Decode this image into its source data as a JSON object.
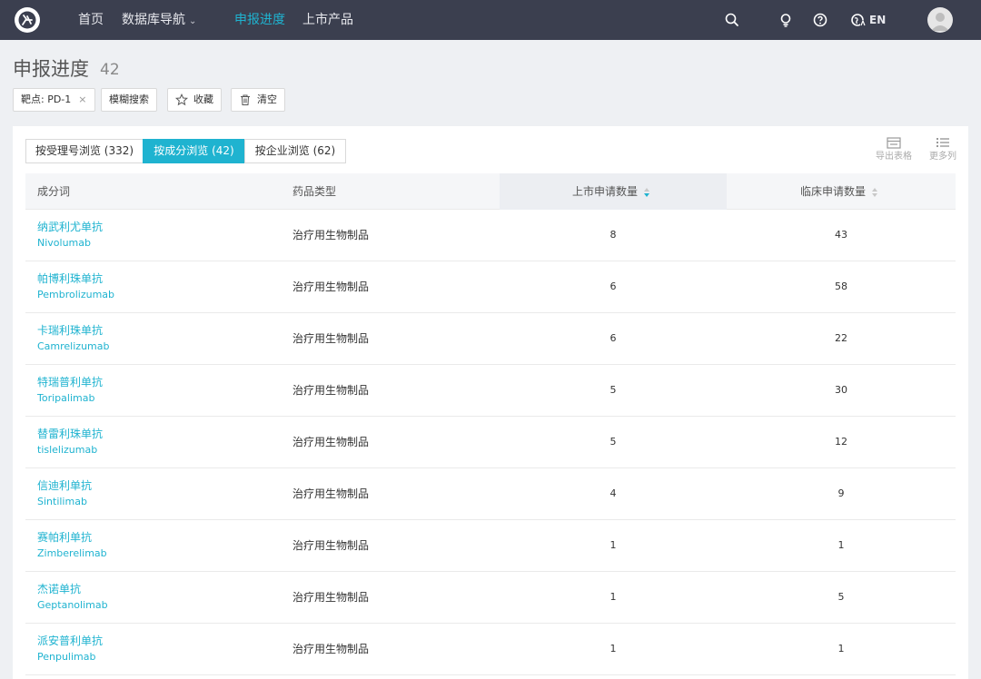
{
  "nav": {
    "items": [
      "首页",
      "数据库导航",
      "申报进度",
      "上市产品"
    ],
    "active_index": 2,
    "lang": "EN",
    "icons": [
      "logo-icon",
      "search-icon",
      "lightbulb-icon",
      "help-icon",
      "language-icon",
      "avatar-icon"
    ],
    "accent": "#1fb3d0",
    "bar_color": "#3b3f4f"
  },
  "header": {
    "title": "申报进度",
    "count": "42"
  },
  "filters": {
    "target_chip": "靶点: PD-1",
    "remove_symbol": "×",
    "fuzzy_search": "模糊搜索",
    "favorite": "收藏",
    "clear": "清空"
  },
  "tabs": [
    {
      "label": "按受理号浏览 (332)",
      "active": false
    },
    {
      "label": "按成分浏览 (42)",
      "active": true
    },
    {
      "label": "按企业浏览 (62)",
      "active": false
    }
  ],
  "tools": {
    "export": "导出表格",
    "more_columns": "更多列"
  },
  "table": {
    "headers": [
      "成分词",
      "药品类型",
      "上市申请数量",
      "临床申请数量"
    ],
    "sorted_column": 2,
    "rows": [
      {
        "cn": "纳武利尤单抗",
        "en": "Nivolumab",
        "type": "治疗用生物制品",
        "market": "8",
        "clinical": "43"
      },
      {
        "cn": "帕博利珠单抗",
        "en": "Pembrolizumab",
        "type": "治疗用生物制品",
        "market": "6",
        "clinical": "58"
      },
      {
        "cn": "卡瑞利珠单抗",
        "en": "Camrelizumab",
        "type": "治疗用生物制品",
        "market": "6",
        "clinical": "22"
      },
      {
        "cn": "特瑞普利单抗",
        "en": "Toripalimab",
        "type": "治疗用生物制品",
        "market": "5",
        "clinical": "30"
      },
      {
        "cn": "替雷利珠单抗",
        "en": "tislelizumab",
        "type": "治疗用生物制品",
        "market": "5",
        "clinical": "12"
      },
      {
        "cn": "信迪利单抗",
        "en": "Sintilimab",
        "type": "治疗用生物制品",
        "market": "4",
        "clinical": "9"
      },
      {
        "cn": "赛帕利单抗",
        "en": "Zimberelimab",
        "type": "治疗用生物制品",
        "market": "1",
        "clinical": "1"
      },
      {
        "cn": "杰诺单抗",
        "en": "Geptanolimab",
        "type": "治疗用生物制品",
        "market": "1",
        "clinical": "5"
      },
      {
        "cn": "派安普利单抗",
        "en": "Penpulimab",
        "type": "治疗用生物制品",
        "market": "1",
        "clinical": "1"
      }
    ]
  }
}
